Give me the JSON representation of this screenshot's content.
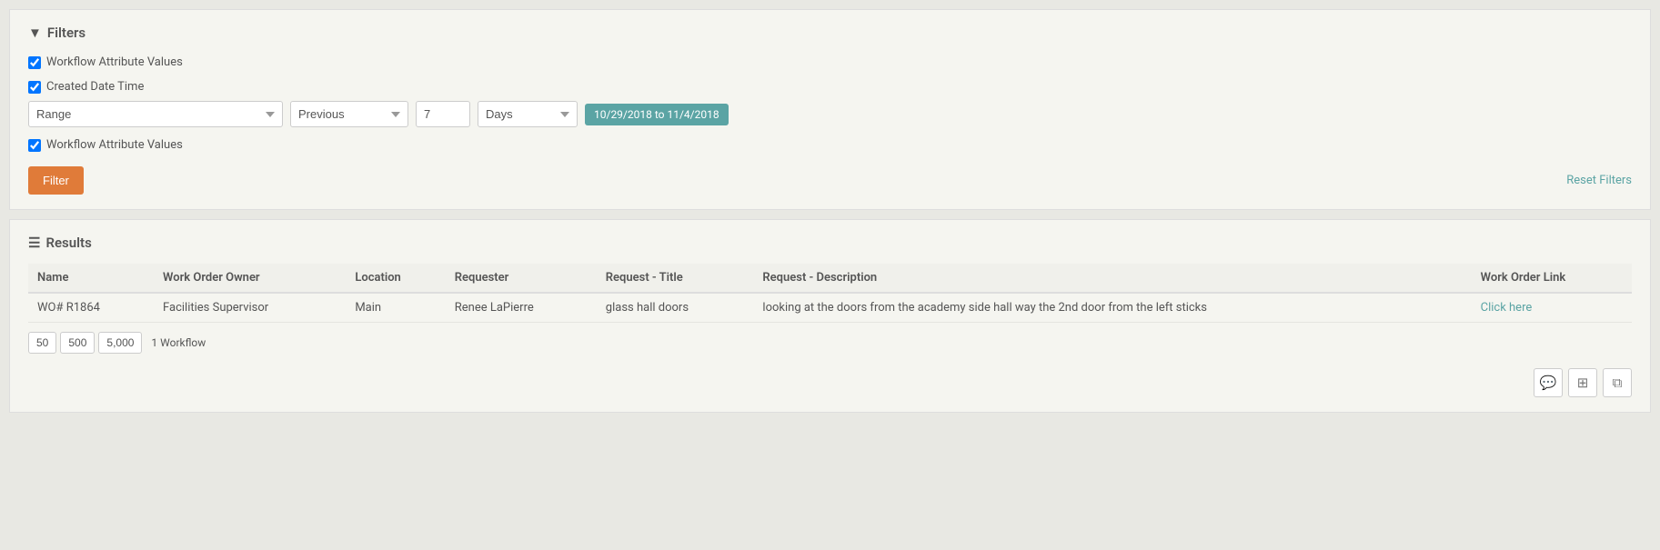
{
  "filters": {
    "title": "Filters",
    "filter_icon": "funnel-icon",
    "checkbox1": {
      "label": "Workflow Attribute Values",
      "checked": true
    },
    "date_filter": {
      "label": "Created Date Time",
      "checked": true,
      "range_options": [
        "Range"
      ],
      "range_value": "Range",
      "previous_options": [
        "Previous"
      ],
      "previous_value": "Previous",
      "number_value": "7",
      "period_options": [
        "Days"
      ],
      "period_value": "Days",
      "date_badge": "10/29/2018 to 11/4/2018"
    },
    "checkbox2": {
      "label": "Workflow Attribute Values",
      "checked": true
    },
    "filter_button": "Filter",
    "reset_link": "Reset Filters"
  },
  "results": {
    "title": "Results",
    "columns": [
      "Name",
      "Work Order Owner",
      "Location",
      "Requester",
      "Request - Title",
      "Request - Description",
      "Work Order Link"
    ],
    "rows": [
      {
        "name": "WO# R1864",
        "work_order_owner": "Facilities Supervisor",
        "location": "Main",
        "requester": "Renee LaPierre",
        "request_title": "glass hall doors",
        "request_description": "looking at the doors from the academy side hall way the 2nd door from the left sticks",
        "work_order_link": "Click here"
      }
    ],
    "page_sizes": [
      "50",
      "500",
      "5,000"
    ],
    "workflow_count": "1 Workflow",
    "icons": {
      "chat": "💬",
      "grid": "⊞",
      "copy": "⧉"
    }
  }
}
